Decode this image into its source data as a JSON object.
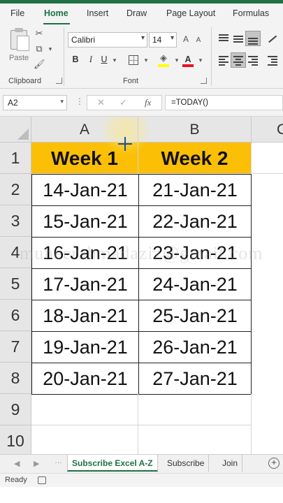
{
  "ribbon_tabs": [
    "File",
    "Home",
    "Insert",
    "Draw",
    "Page Layout",
    "Formulas"
  ],
  "ribbon": {
    "paste_label": "Paste",
    "clipboard_label": "Clipboard",
    "font_label": "Font",
    "font_name": "Calibri",
    "font_size": "14",
    "bold_glyph": "B",
    "italic_glyph": "I",
    "underline_glyph": "U",
    "font_color_glyph": "A",
    "highlight_color": "#ffff00",
    "font_color": "#e81123"
  },
  "formula_bar": {
    "name_box": "A2",
    "cancel_glyph": "✕",
    "enter_glyph": "✓",
    "fx_glyph": "fx",
    "formula": "=TODAY()"
  },
  "grid": {
    "columns": [
      "A",
      "B",
      "C"
    ],
    "rows": [
      "1",
      "2",
      "3",
      "4",
      "5",
      "6",
      "7",
      "8",
      "9",
      "10"
    ],
    "header_row": [
      "Week 1",
      "Week 2"
    ],
    "data": [
      [
        "14-Jan-21",
        "21-Jan-21"
      ],
      [
        "15-Jan-21",
        "22-Jan-21"
      ],
      [
        "16-Jan-21",
        "23-Jan-21"
      ],
      [
        "17-Jan-21",
        "24-Jan-21"
      ],
      [
        "18-Jan-21",
        "25-Jan-21"
      ],
      [
        "19-Jan-21",
        "26-Jan-21"
      ],
      [
        "20-Jan-21",
        "27-Jan-21"
      ]
    ],
    "header_fill": "#fbbf05",
    "watermark": "muneerahmadaziz@gmail.com"
  },
  "sheet_tabs": {
    "tabs": [
      "Subscribe Excel A-Z",
      "Subscribe",
      "Join"
    ],
    "active": "Subscribe Excel A-Z",
    "prev_glyph": "◀",
    "next_glyph": "▶",
    "more_glyph": "…",
    "add_glyph": "+"
  },
  "status": {
    "text": "Ready"
  },
  "accent": "#1e7145"
}
